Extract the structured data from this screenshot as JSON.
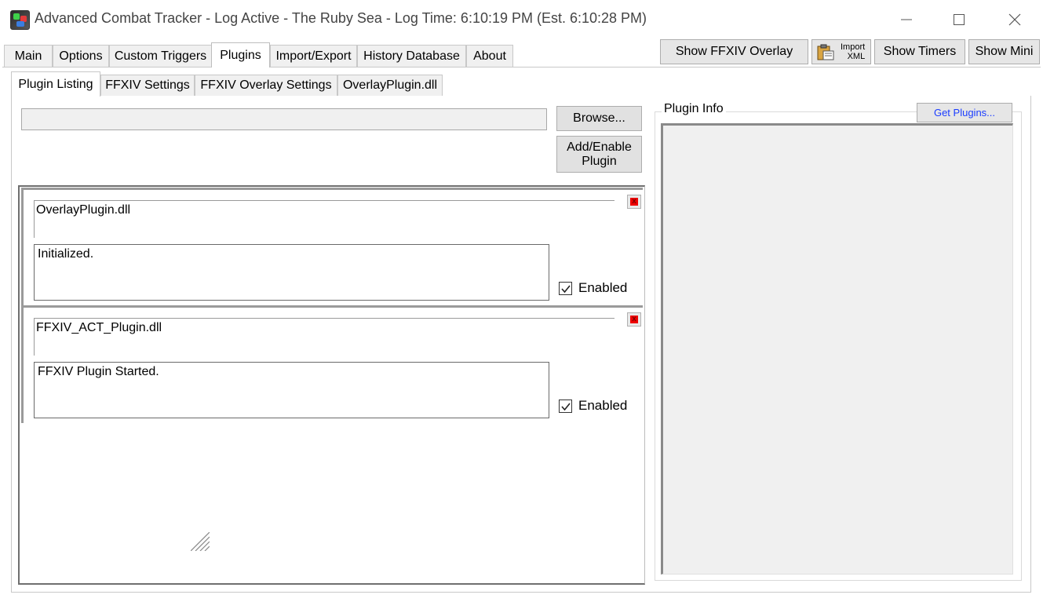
{
  "window": {
    "title": "Advanced Combat Tracker - Log Active - The Ruby Sea - Log Time: 6:10:19 PM (Est. 6:10:28 PM)",
    "icon": "act-app-icon"
  },
  "main_tabs": [
    {
      "label": "Main"
    },
    {
      "label": "Options"
    },
    {
      "label": "Custom Triggers"
    },
    {
      "label": "Plugins",
      "active": true
    },
    {
      "label": "Import/Export"
    },
    {
      "label": "History Database"
    },
    {
      "label": "About"
    }
  ],
  "toolbar": {
    "show_overlay": "Show FFXIV Overlay",
    "import_xml_top": "Import",
    "import_xml_bottom": "XML",
    "show_timers": "Show Timers",
    "show_mini": "Show Mini"
  },
  "sub_tabs": [
    {
      "label": "Plugin Listing",
      "active": true
    },
    {
      "label": "FFXIV Settings"
    },
    {
      "label": "FFXIV Overlay Settings"
    },
    {
      "label": "OverlayPlugin.dll"
    }
  ],
  "plugin_listing": {
    "path_value": "",
    "browse_label": "Browse...",
    "add_enable_label": "Add/Enable Plugin",
    "plugins": [
      {
        "name": "OverlayPlugin.dll",
        "status": "Initialized.",
        "enabled_label": "Enabled",
        "enabled": true
      },
      {
        "name": "FFXIV_ACT_Plugin.dll",
        "status": "FFXIV Plugin Started.",
        "enabled_label": "Enabled",
        "enabled": true
      }
    ]
  },
  "plugin_info": {
    "legend": "Plugin Info",
    "get_plugins_label": "Get Plugins..."
  },
  "colors": {
    "get_plugins_text": "#1a3cff",
    "remove_button": "#e00000"
  }
}
